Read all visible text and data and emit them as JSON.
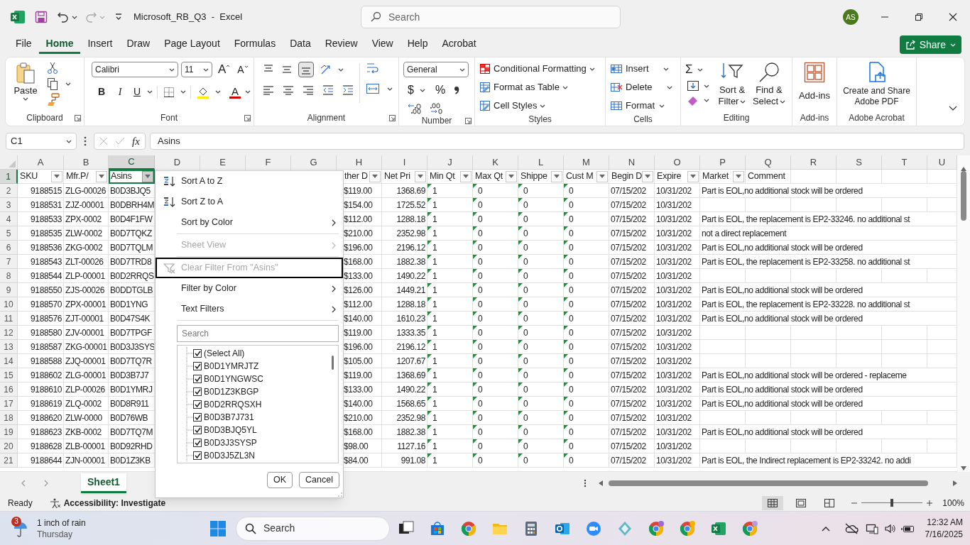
{
  "title_bar": {
    "title": "Microsoft_RB_Q3  -  Excel",
    "search_placeholder": "Search",
    "avatar": "AS"
  },
  "ribbon_tabs": [
    {
      "label": "File",
      "selected": false
    },
    {
      "label": "Home",
      "selected": true
    },
    {
      "label": "Insert",
      "selected": false
    },
    {
      "label": "Draw",
      "selected": false
    },
    {
      "label": "Page Layout",
      "selected": false
    },
    {
      "label": "Formulas",
      "selected": false
    },
    {
      "label": "Data",
      "selected": false
    },
    {
      "label": "Review",
      "selected": false
    },
    {
      "label": "View",
      "selected": false
    },
    {
      "label": "Help",
      "selected": false
    },
    {
      "label": "Acrobat",
      "selected": false
    }
  ],
  "share_button": "Share",
  "ribbon": {
    "clipboard": {
      "paste": "Paste",
      "group": "Clipboard"
    },
    "font": {
      "name": "Calibri",
      "size": "11",
      "grow": "A",
      "shrink": "A",
      "bold": "B",
      "italic": "I",
      "underline": "U",
      "font_color": "A",
      "group": "Font"
    },
    "alignment": {
      "group": "Alignment"
    },
    "number": {
      "format": "General",
      "currency": "$",
      "percent": "%",
      "group": "Number"
    },
    "styles": {
      "items": [
        "Conditional Formatting",
        "Format as Table",
        "Cell Styles"
      ],
      "group": "Styles"
    },
    "cells": {
      "items": [
        "Insert",
        "Delete",
        "Format"
      ],
      "group": "Cells"
    },
    "editing": {
      "sum": "Σ",
      "sort": "Sort & Filter",
      "find": "Find & Select",
      "group": "Editing"
    },
    "addins": {
      "label": "Add-ins",
      "group": "Add-ins"
    },
    "acrobat": {
      "label": "Create and Share Adobe PDF",
      "group": "Adobe Acrobat"
    }
  },
  "formula_bar": {
    "name_box": "C1",
    "fx": "fx",
    "formula": "Asins"
  },
  "sheet": {
    "columns": [
      {
        "letter": "A",
        "header": "SKU",
        "filter_active": false,
        "kind": "number",
        "selected": false
      },
      {
        "letter": "B",
        "header": "Mfr.P/",
        "filter_active": false,
        "kind": "text",
        "selected": false
      },
      {
        "letter": "C",
        "header": "Asins",
        "filter_active": true,
        "kind": "text",
        "selected": true
      },
      {
        "letter": "D",
        "selected": false
      },
      {
        "letter": "E",
        "selected": false
      },
      {
        "letter": "F",
        "selected": false
      },
      {
        "letter": "G",
        "selected": false
      },
      {
        "letter": "H",
        "header": "ther D",
        "filter_active": false,
        "kind": "text",
        "selected": false
      },
      {
        "letter": "I",
        "header": "Net Pri",
        "filter_active": false,
        "kind": "number",
        "selected": false
      },
      {
        "letter": "J",
        "header": "Min Qt",
        "filter_active": false,
        "kind": "text",
        "flag": true,
        "selected": false
      },
      {
        "letter": "K",
        "header": "Max Qt",
        "filter_active": false,
        "kind": "text",
        "flag": true,
        "selected": false
      },
      {
        "letter": "L",
        "header": "Shippe",
        "filter_active": false,
        "kind": "text",
        "flag": true,
        "selected": false
      },
      {
        "letter": "M",
        "header": "Cust M",
        "filter_active": false,
        "kind": "text",
        "flag": true,
        "selected": false
      },
      {
        "letter": "N",
        "header": "Begin D",
        "filter_active": false,
        "kind": "text",
        "selected": false
      },
      {
        "letter": "O",
        "header": "Expire",
        "filter_active": false,
        "kind": "text",
        "selected": false
      },
      {
        "letter": "P",
        "header": "Market",
        "filter_active": false,
        "kind": "text",
        "overflow": true,
        "selected": false
      },
      {
        "letter": "Q",
        "header": "Comment",
        "kind": "text",
        "selected": false
      },
      {
        "letter": "R",
        "selected": false
      },
      {
        "letter": "S",
        "selected": false
      },
      {
        "letter": "T",
        "selected": false
      },
      {
        "letter": "U",
        "selected": false
      }
    ],
    "header_row": {
      "number": "1",
      "selected": true
    },
    "rows": [
      {
        "number": "2",
        "cells": {
          "A": "9188515",
          "B": "ZLG-00026",
          "C": "B0D3BJQ5",
          "H": "$119.00",
          "I": "1368.69",
          "J": "1",
          "K": "0",
          "L": "0",
          "M": "0",
          "N": "07/15/202",
          "O": "10/31/202",
          "P": "Part is EOL,no additional stock will be ordered"
        }
      },
      {
        "number": "3",
        "cells": {
          "A": "9188531",
          "B": "ZJZ-00001",
          "C": "B0DBRH4M",
          "H": "$154.00",
          "I": "1725.52",
          "J": "1",
          "K": "0",
          "L": "0",
          "M": "0",
          "N": "07/15/202",
          "O": "10/31/202"
        }
      },
      {
        "number": "4",
        "cells": {
          "A": "9188533",
          "B": "ZPX-0002",
          "C": "B0D4F1FW",
          "H": "$112.00",
          "I": "1288.18",
          "J": "1",
          "K": "0",
          "L": "0",
          "M": "0",
          "N": "07/15/202",
          "O": "10/31/202",
          "P": "Part is EOL, the replacement is EP2-33246. no additional st"
        }
      },
      {
        "number": "5",
        "cells": {
          "A": "9188535",
          "B": "ZLW-0002",
          "C": "B0D7TQKZ",
          "H": "$210.00",
          "I": "2352.98",
          "J": "1",
          "K": "0",
          "L": "0",
          "M": "0",
          "N": "07/15/202",
          "O": "10/31/202",
          "P": "not a direct replacement"
        }
      },
      {
        "number": "6",
        "cells": {
          "A": "9188536",
          "B": "ZKG-0002",
          "C": "B0D7TQLM",
          "H": "$196.00",
          "I": "2196.12",
          "J": "1",
          "K": "0",
          "L": "0",
          "M": "0",
          "N": "07/15/202",
          "O": "10/31/202",
          "P": "Part is EOL,no additional stock will be ordered"
        }
      },
      {
        "number": "7",
        "cells": {
          "A": "9188543",
          "B": "ZLT-00026",
          "C": "B0D7TRD8",
          "H": "$168.00",
          "I": "1882.38",
          "J": "1",
          "K": "0",
          "L": "0",
          "M": "0",
          "N": "07/15/202",
          "O": "10/31/202",
          "P": "Part is EOL, the replacement is EP2-33258. no additional st"
        }
      },
      {
        "number": "8",
        "cells": {
          "A": "9188544",
          "B": "ZLP-00001",
          "C": "B0D2RRQS",
          "H": "$133.00",
          "I": "1490.22",
          "J": "1",
          "K": "0",
          "L": "0",
          "M": "0",
          "N": "07/15/202",
          "O": "10/31/202"
        }
      },
      {
        "number": "9",
        "cells": {
          "A": "9188550",
          "B": "ZJS-00026",
          "C": "B0DDTGLB",
          "H": "$126.00",
          "I": "1449.21",
          "J": "1",
          "K": "0",
          "L": "0",
          "M": "0",
          "N": "07/15/202",
          "O": "10/31/202",
          "P": "Part is EOL,no additional stock will be ordered"
        }
      },
      {
        "number": "10",
        "cells": {
          "A": "9188570",
          "B": "ZPX-00001",
          "C": "B0D1YNG",
          "H": "$112.00",
          "I": "1288.18",
          "J": "1",
          "K": "0",
          "L": "0",
          "M": "0",
          "N": "07/15/202",
          "O": "10/31/202",
          "P": "Part is EOL, the replacement is EP2-33228. no additional st"
        }
      },
      {
        "number": "11",
        "cells": {
          "A": "9188576",
          "B": "ZJT-00001",
          "C": "B0D47S4K",
          "H": "$140.00",
          "I": "1610.23",
          "J": "1",
          "K": "0",
          "L": "0",
          "M": "0",
          "N": "07/15/202",
          "O": "10/31/202",
          "P": "Part is EOL,no additional stock will be ordered"
        }
      },
      {
        "number": "12",
        "cells": {
          "A": "9188580",
          "B": "ZJV-00001",
          "C": "B0D7TPGF",
          "H": "$119.00",
          "I": "1333.35",
          "J": "1",
          "K": "0",
          "L": "0",
          "M": "0",
          "N": "07/15/202",
          "O": "10/31/202"
        }
      },
      {
        "number": "13",
        "cells": {
          "A": "9188587",
          "B": "ZKG-00001",
          "C": "B0D3J3SYS",
          "H": "$196.00",
          "I": "2196.12",
          "J": "1",
          "K": "0",
          "L": "0",
          "M": "0",
          "N": "07/15/202",
          "O": "10/31/202"
        }
      },
      {
        "number": "14",
        "cells": {
          "A": "9188588",
          "B": "ZJQ-00001",
          "C": "B0D7TQ7R",
          "H": "$105.00",
          "I": "1207.67",
          "J": "1",
          "K": "0",
          "L": "0",
          "M": "0",
          "N": "07/15/202",
          "O": "10/31/202"
        }
      },
      {
        "number": "15",
        "cells": {
          "A": "9188602",
          "B": "ZLG-00001",
          "C": "B0D3B7J7",
          "H": "$119.00",
          "I": "1368.69",
          "J": "1",
          "K": "0",
          "L": "0",
          "M": "0",
          "N": "07/15/202",
          "O": "10/31/202",
          "P": "Part is EOL,no additional stock will be ordered - replaceme"
        }
      },
      {
        "number": "16",
        "cells": {
          "A": "9188610",
          "B": "ZLP-00026",
          "C": "B0D1YMRJ",
          "H": "$133.00",
          "I": "1490.22",
          "J": "1",
          "K": "0",
          "L": "0",
          "M": "0",
          "N": "07/15/202",
          "O": "10/31/202",
          "P": "Part is EOL,no additional stock will be ordered"
        }
      },
      {
        "number": "17",
        "cells": {
          "A": "9188619",
          "B": "ZLQ-0002",
          "C": "B0D8R911",
          "H": "$140.00",
          "I": "1568.65",
          "J": "1",
          "K": "0",
          "L": "0",
          "M": "0",
          "N": "07/15/202",
          "O": "10/31/202",
          "P": "Part is EOL,no additional stock will be ordered"
        }
      },
      {
        "number": "18",
        "cells": {
          "A": "9188620",
          "B": "ZLW-0000",
          "C": "B0D76WB",
          "H": "$210.00",
          "I": "2352.98",
          "J": "1",
          "K": "0",
          "L": "0",
          "M": "0",
          "N": "07/15/202",
          "O": "10/31/202"
        }
      },
      {
        "number": "19",
        "cells": {
          "A": "9188623",
          "B": "ZKB-0002",
          "C": "B0D7TQ7M",
          "H": "$168.00",
          "I": "1882.38",
          "J": "1",
          "K": "0",
          "L": "0",
          "M": "0",
          "N": "07/15/202",
          "O": "10/31/202",
          "P": "Part is EOL,no additional stock will be ordered"
        }
      },
      {
        "number": "20",
        "cells": {
          "A": "9188628",
          "B": "ZLB-00001",
          "C": "B0D92RHD",
          "H": "$98.00",
          "I": "1127.16",
          "J": "1",
          "K": "0",
          "L": "0",
          "M": "0",
          "N": "07/15/202",
          "O": "10/31/202"
        }
      },
      {
        "number": "21",
        "cells": {
          "A": "9188644",
          "B": "ZJN-00001",
          "C": "B0D1Z3KB",
          "H": "$84.00",
          "I": "991.08",
          "J": "1",
          "K": "0",
          "L": "0",
          "M": "0",
          "N": "07/15/202",
          "O": "10/31/202",
          "P": "Part is EOL, the Indirect replacement is EP2-33242. no addi"
        }
      }
    ]
  },
  "filter_menu": {
    "items": [
      {
        "label": "Sort A to Z",
        "kind": "sort_asc",
        "disabled": false,
        "submenu": false,
        "focused": false
      },
      {
        "label": "Sort Z to A",
        "kind": "sort_desc",
        "disabled": false,
        "submenu": false,
        "focused": false
      },
      {
        "label": "Sort by Color",
        "kind": "plain",
        "disabled": false,
        "submenu": true,
        "focused": false
      },
      {
        "kind": "separator"
      },
      {
        "label": "Sheet View",
        "kind": "plain",
        "disabled": true,
        "submenu": true,
        "focused": false
      },
      {
        "kind": "separator"
      },
      {
        "label": "Clear Filter From \"Asins\"",
        "kind": "clear_filter",
        "disabled": true,
        "submenu": false,
        "focused": true
      },
      {
        "label": "Filter by Color",
        "kind": "plain",
        "disabled": false,
        "submenu": true,
        "focused": false
      },
      {
        "label": "Text Filters",
        "kind": "plain",
        "disabled": false,
        "submenu": true,
        "focused": false
      },
      {
        "kind": "separator"
      }
    ],
    "search_placeholder": "Search",
    "values": [
      {
        "label": "(Select All)",
        "checked": true
      },
      {
        "label": "B0D1YMRJTZ",
        "checked": true
      },
      {
        "label": "B0D1YNGWSC",
        "checked": true
      },
      {
        "label": "B0D1Z3KBGP",
        "checked": true
      },
      {
        "label": "B0D2RRQSXH",
        "checked": true
      },
      {
        "label": "B0D3B7J731",
        "checked": true
      },
      {
        "label": "B0D3BJQ5YL",
        "checked": true
      },
      {
        "label": "B0D3J3SYSP",
        "checked": true
      },
      {
        "label": "B0D3J5ZL3N",
        "checked": true
      }
    ],
    "buttons": [
      "OK",
      "Cancel"
    ]
  },
  "sheet_tabs": [
    {
      "label": "Sheet1",
      "selected": true
    }
  ],
  "status_bar": {
    "ready": "Ready",
    "accessibility": "Accessibility: Investigate",
    "views": [
      {
        "kind": "normal",
        "selected": true
      },
      {
        "kind": "page_layout",
        "selected": false
      },
      {
        "kind": "page_break",
        "selected": false
      }
    ],
    "level": 0.5,
    "zoom": "100%"
  },
  "taskbar": {
    "weather": {
      "badge": "3",
      "line1": "1 inch of rain",
      "line2": "Thursday"
    },
    "search_placeholder": "Search",
    "time": "12:32 AM",
    "date": "7/16/2025"
  }
}
